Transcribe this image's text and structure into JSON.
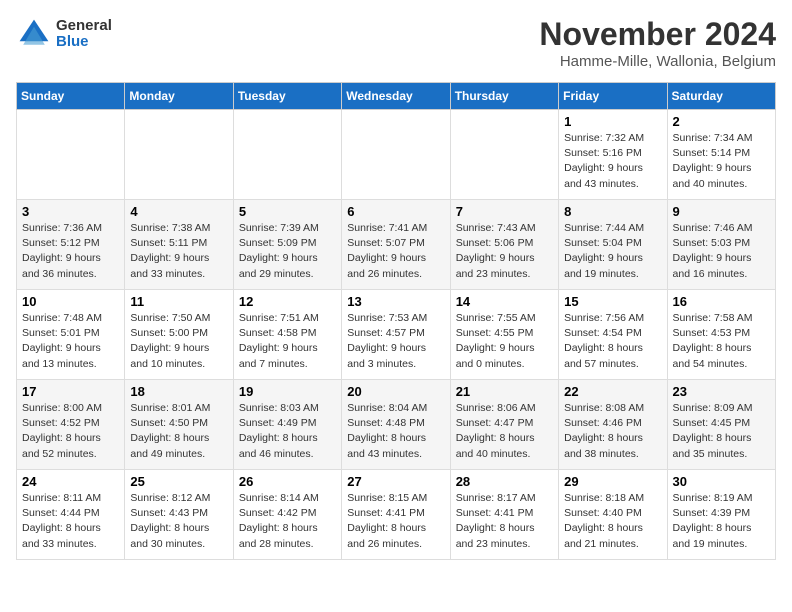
{
  "logo": {
    "general": "General",
    "blue": "Blue"
  },
  "title": "November 2024",
  "location": "Hamme-Mille, Wallonia, Belgium",
  "days_of_week": [
    "Sunday",
    "Monday",
    "Tuesday",
    "Wednesday",
    "Thursday",
    "Friday",
    "Saturday"
  ],
  "weeks": [
    [
      {
        "day": "",
        "info": ""
      },
      {
        "day": "",
        "info": ""
      },
      {
        "day": "",
        "info": ""
      },
      {
        "day": "",
        "info": ""
      },
      {
        "day": "",
        "info": ""
      },
      {
        "day": "1",
        "info": "Sunrise: 7:32 AM\nSunset: 5:16 PM\nDaylight: 9 hours and 43 minutes."
      },
      {
        "day": "2",
        "info": "Sunrise: 7:34 AM\nSunset: 5:14 PM\nDaylight: 9 hours and 40 minutes."
      }
    ],
    [
      {
        "day": "3",
        "info": "Sunrise: 7:36 AM\nSunset: 5:12 PM\nDaylight: 9 hours and 36 minutes."
      },
      {
        "day": "4",
        "info": "Sunrise: 7:38 AM\nSunset: 5:11 PM\nDaylight: 9 hours and 33 minutes."
      },
      {
        "day": "5",
        "info": "Sunrise: 7:39 AM\nSunset: 5:09 PM\nDaylight: 9 hours and 29 minutes."
      },
      {
        "day": "6",
        "info": "Sunrise: 7:41 AM\nSunset: 5:07 PM\nDaylight: 9 hours and 26 minutes."
      },
      {
        "day": "7",
        "info": "Sunrise: 7:43 AM\nSunset: 5:06 PM\nDaylight: 9 hours and 23 minutes."
      },
      {
        "day": "8",
        "info": "Sunrise: 7:44 AM\nSunset: 5:04 PM\nDaylight: 9 hours and 19 minutes."
      },
      {
        "day": "9",
        "info": "Sunrise: 7:46 AM\nSunset: 5:03 PM\nDaylight: 9 hours and 16 minutes."
      }
    ],
    [
      {
        "day": "10",
        "info": "Sunrise: 7:48 AM\nSunset: 5:01 PM\nDaylight: 9 hours and 13 minutes."
      },
      {
        "day": "11",
        "info": "Sunrise: 7:50 AM\nSunset: 5:00 PM\nDaylight: 9 hours and 10 minutes."
      },
      {
        "day": "12",
        "info": "Sunrise: 7:51 AM\nSunset: 4:58 PM\nDaylight: 9 hours and 7 minutes."
      },
      {
        "day": "13",
        "info": "Sunrise: 7:53 AM\nSunset: 4:57 PM\nDaylight: 9 hours and 3 minutes."
      },
      {
        "day": "14",
        "info": "Sunrise: 7:55 AM\nSunset: 4:55 PM\nDaylight: 9 hours and 0 minutes."
      },
      {
        "day": "15",
        "info": "Sunrise: 7:56 AM\nSunset: 4:54 PM\nDaylight: 8 hours and 57 minutes."
      },
      {
        "day": "16",
        "info": "Sunrise: 7:58 AM\nSunset: 4:53 PM\nDaylight: 8 hours and 54 minutes."
      }
    ],
    [
      {
        "day": "17",
        "info": "Sunrise: 8:00 AM\nSunset: 4:52 PM\nDaylight: 8 hours and 52 minutes."
      },
      {
        "day": "18",
        "info": "Sunrise: 8:01 AM\nSunset: 4:50 PM\nDaylight: 8 hours and 49 minutes."
      },
      {
        "day": "19",
        "info": "Sunrise: 8:03 AM\nSunset: 4:49 PM\nDaylight: 8 hours and 46 minutes."
      },
      {
        "day": "20",
        "info": "Sunrise: 8:04 AM\nSunset: 4:48 PM\nDaylight: 8 hours and 43 minutes."
      },
      {
        "day": "21",
        "info": "Sunrise: 8:06 AM\nSunset: 4:47 PM\nDaylight: 8 hours and 40 minutes."
      },
      {
        "day": "22",
        "info": "Sunrise: 8:08 AM\nSunset: 4:46 PM\nDaylight: 8 hours and 38 minutes."
      },
      {
        "day": "23",
        "info": "Sunrise: 8:09 AM\nSunset: 4:45 PM\nDaylight: 8 hours and 35 minutes."
      }
    ],
    [
      {
        "day": "24",
        "info": "Sunrise: 8:11 AM\nSunset: 4:44 PM\nDaylight: 8 hours and 33 minutes."
      },
      {
        "day": "25",
        "info": "Sunrise: 8:12 AM\nSunset: 4:43 PM\nDaylight: 8 hours and 30 minutes."
      },
      {
        "day": "26",
        "info": "Sunrise: 8:14 AM\nSunset: 4:42 PM\nDaylight: 8 hours and 28 minutes."
      },
      {
        "day": "27",
        "info": "Sunrise: 8:15 AM\nSunset: 4:41 PM\nDaylight: 8 hours and 26 minutes."
      },
      {
        "day": "28",
        "info": "Sunrise: 8:17 AM\nSunset: 4:41 PM\nDaylight: 8 hours and 23 minutes."
      },
      {
        "day": "29",
        "info": "Sunrise: 8:18 AM\nSunset: 4:40 PM\nDaylight: 8 hours and 21 minutes."
      },
      {
        "day": "30",
        "info": "Sunrise: 8:19 AM\nSunset: 4:39 PM\nDaylight: 8 hours and 19 minutes."
      }
    ]
  ]
}
